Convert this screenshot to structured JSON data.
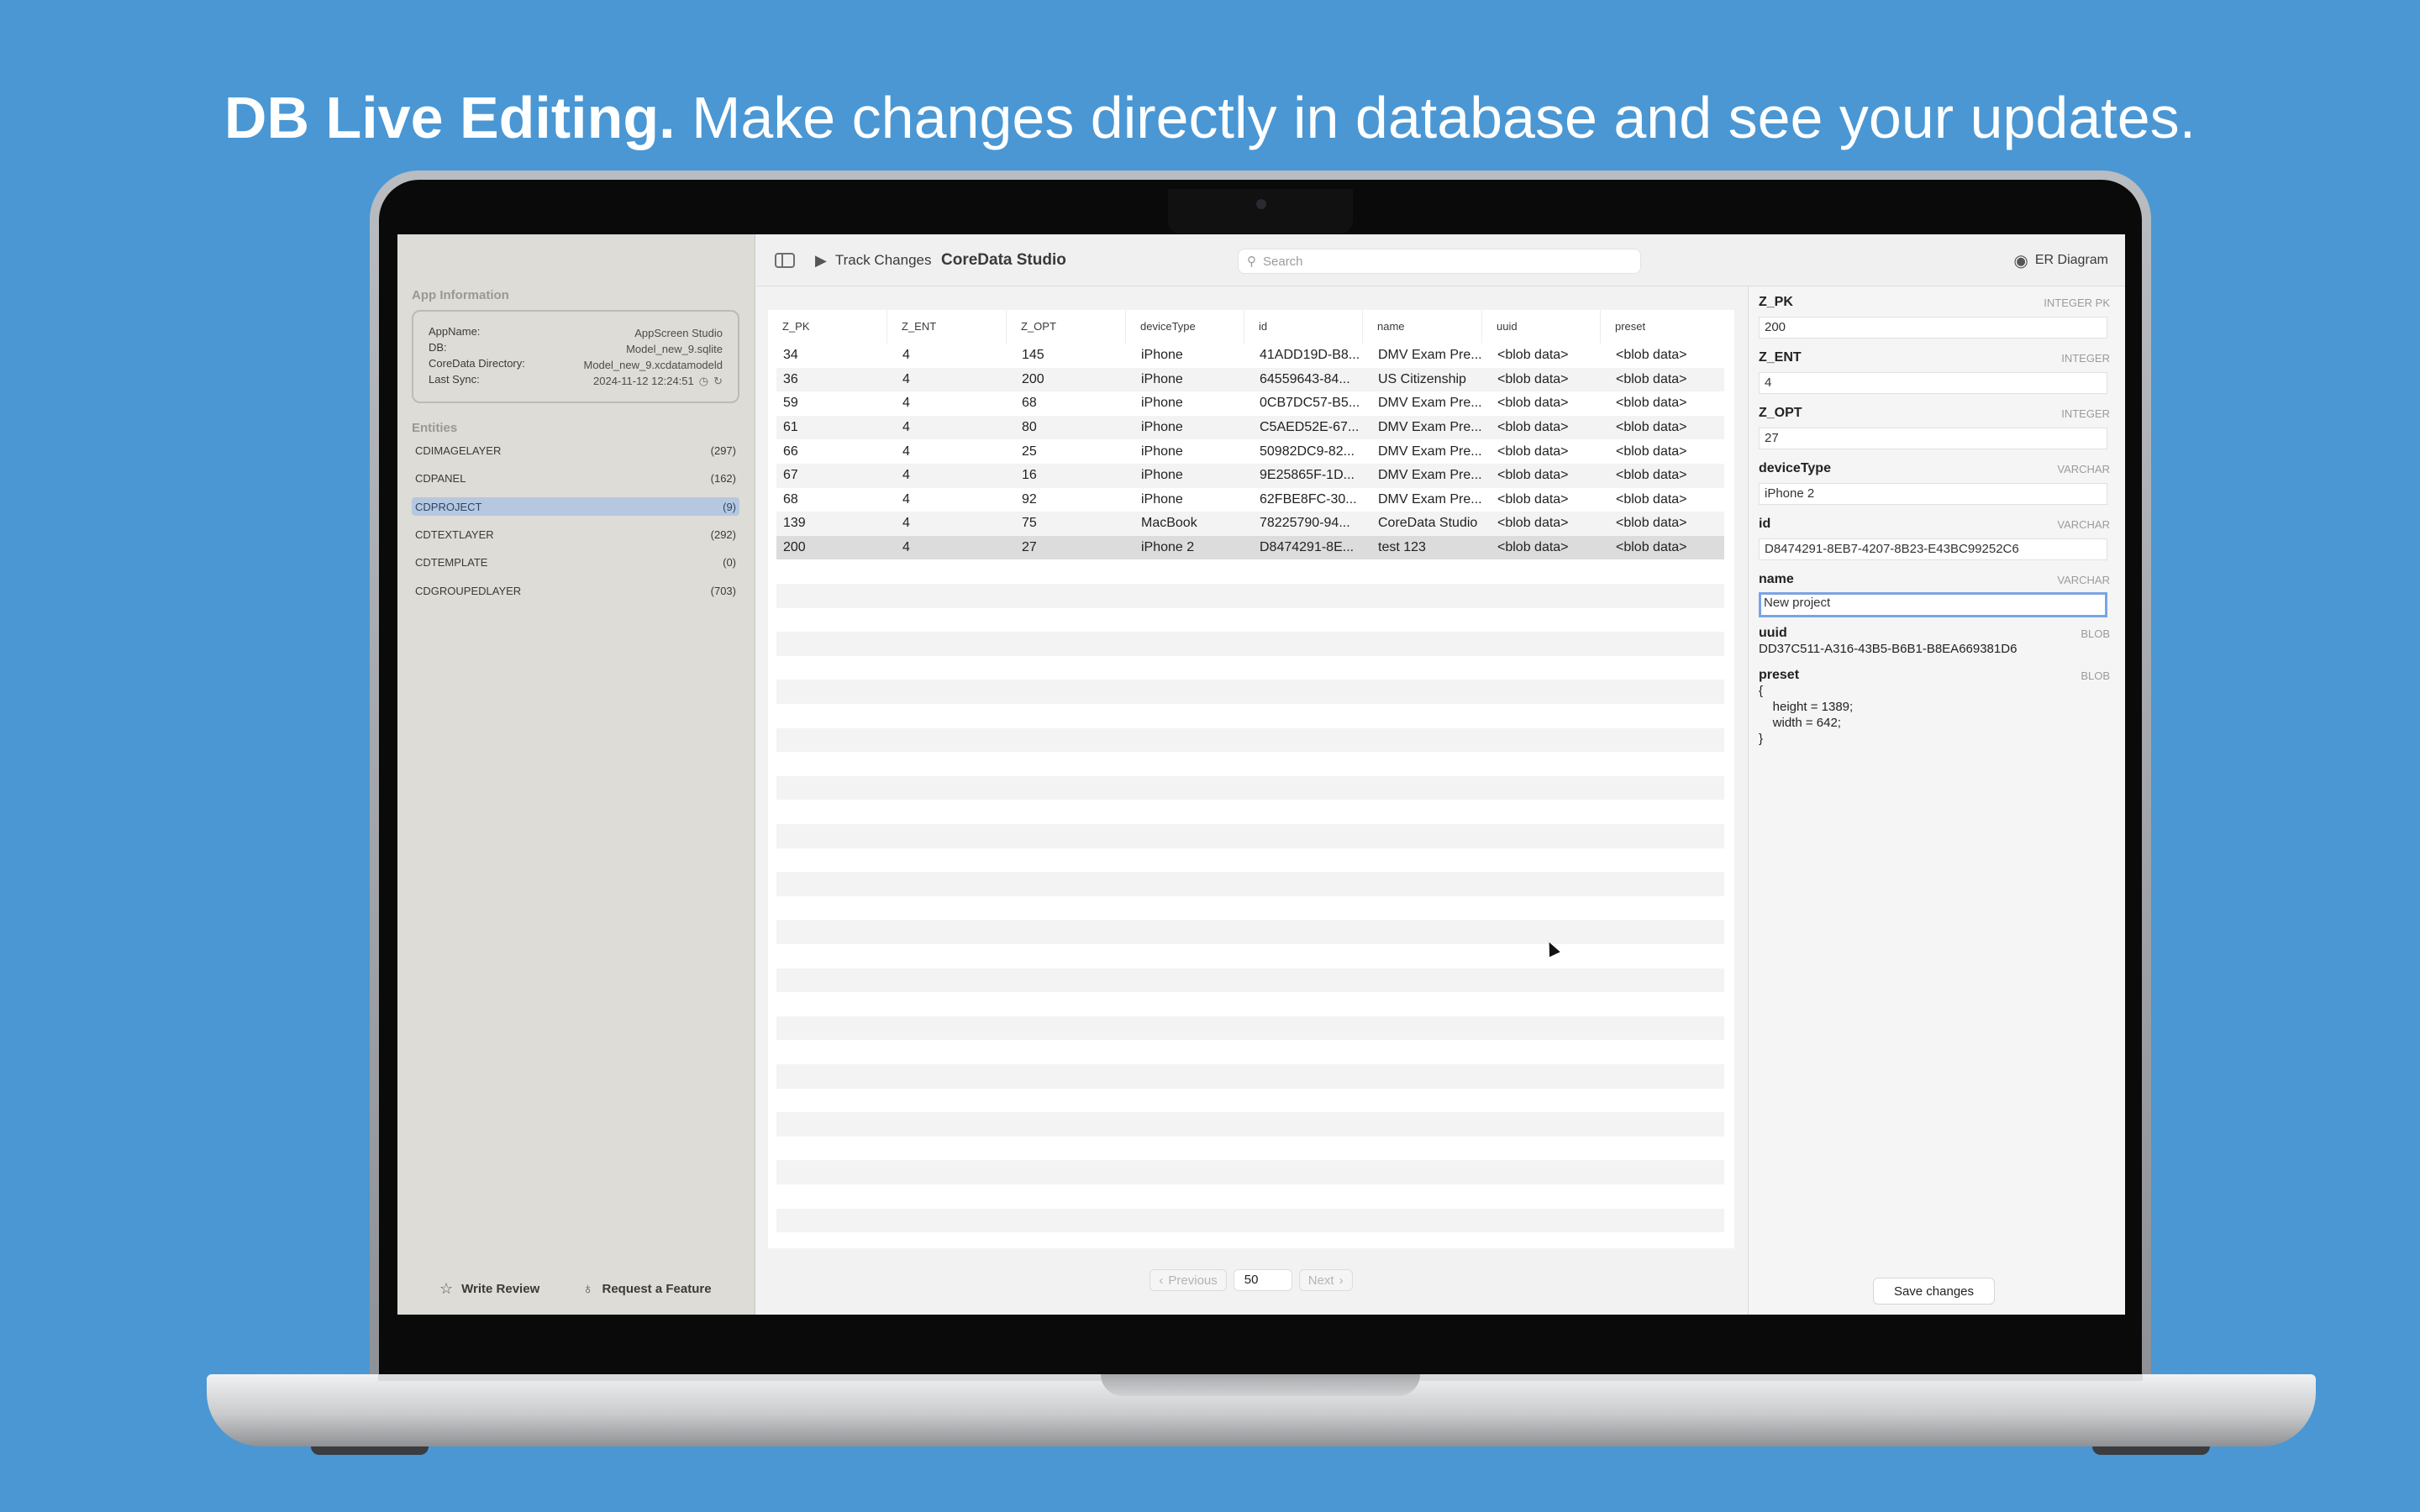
{
  "headline": {
    "bold": "DB Live Editing.",
    "rest": "Make changes directly in database and see your updates."
  },
  "sidebar": {
    "app_info_title": "App Information",
    "app_info": [
      {
        "key": "AppName:",
        "value": "AppScreen Studio"
      },
      {
        "key": "DB:",
        "value": "Model_new_9.sqlite"
      },
      {
        "key": "CoreData Directory:",
        "value": "Model_new_9.xcdatamodeld"
      },
      {
        "key": "Last Sync:",
        "value": "2024-11-12 12:24:51"
      }
    ],
    "entities_title": "Entities",
    "entities": [
      {
        "name": "CDIMAGELAYER",
        "count": "(297)"
      },
      {
        "name": "CDPANEL",
        "count": "(162)"
      },
      {
        "name": "CDPROJECT",
        "count": "(9)"
      },
      {
        "name": "CDTEXTLAYER",
        "count": "(292)"
      },
      {
        "name": "CDTEMPLATE",
        "count": "(0)"
      },
      {
        "name": "CDGROUPEDLAYER",
        "count": "(703)"
      }
    ],
    "write_review": "Write Review",
    "request_feature": "Request a Feature"
  },
  "toolbar": {
    "track_changes": "Track Changes",
    "app_title": "CoreData Studio",
    "search_placeholder": "Search",
    "er_diagram": "ER Diagram"
  },
  "table": {
    "columns": [
      "Z_PK",
      "Z_ENT",
      "Z_OPT",
      "deviceType",
      "id",
      "name",
      "uuid",
      "preset"
    ],
    "rows": [
      [
        "34",
        "4",
        "145",
        "iPhone",
        "41ADD19D-B8...",
        "DMV Exam Pre...",
        "<blob data>",
        "<blob data>"
      ],
      [
        "36",
        "4",
        "200",
        "iPhone",
        "64559643-84...",
        "US Citizenship",
        "<blob data>",
        "<blob data>"
      ],
      [
        "59",
        "4",
        "68",
        "iPhone",
        "0CB7DC57-B5...",
        "DMV Exam Pre...",
        "<blob data>",
        "<blob data>"
      ],
      [
        "61",
        "4",
        "80",
        "iPhone",
        "C5AED52E-67...",
        "DMV Exam Pre...",
        "<blob data>",
        "<blob data>"
      ],
      [
        "66",
        "4",
        "25",
        "iPhone",
        "50982DC9-82...",
        "DMV Exam Pre...",
        "<blob data>",
        "<blob data>"
      ],
      [
        "67",
        "4",
        "16",
        "iPhone",
        "9E25865F-1D...",
        "DMV Exam Pre...",
        "<blob data>",
        "<blob data>"
      ],
      [
        "68",
        "4",
        "92",
        "iPhone",
        "62FBE8FC-30...",
        "DMV Exam Pre...",
        "<blob data>",
        "<blob data>"
      ],
      [
        "139",
        "4",
        "75",
        "MacBook",
        "78225790-94...",
        "CoreData Studio",
        "<blob data>",
        "<blob data>"
      ],
      [
        "200",
        "4",
        "27",
        "iPhone 2",
        "D8474291-8E...",
        "test 123",
        "<blob data>",
        "<blob data>"
      ]
    ]
  },
  "pager": {
    "previous": "Previous",
    "page_size": "50",
    "next": "Next"
  },
  "inspector": {
    "fields": [
      {
        "name": "Z_PK",
        "type": "INTEGER  PK",
        "value": "200"
      },
      {
        "name": "Z_ENT",
        "type": "INTEGER",
        "value": "4"
      },
      {
        "name": "Z_OPT",
        "type": "INTEGER",
        "value": "27"
      },
      {
        "name": "deviceType",
        "type": "VARCHAR",
        "value": "iPhone 2"
      },
      {
        "name": "id",
        "type": "VARCHAR",
        "value": "D8474291-8EB7-4207-8B23-E43BC99252C6"
      },
      {
        "name": "name",
        "type": "VARCHAR",
        "value": "New project"
      },
      {
        "name": "uuid",
        "type": "BLOB",
        "value": "DD37C511-A316-43B5-B6B1-B8EA669381D6"
      },
      {
        "name": "preset",
        "type": "BLOB",
        "value": "{\n    height = 1389;\n    width = 642;\n}"
      }
    ],
    "save": "Save changes"
  },
  "colors": {
    "background": "#4a97d4",
    "selection": "#b6c8e0",
    "focus_ring": "#7aa3e6"
  },
  "icons": [
    "sidebar-toggle-icon",
    "play-icon",
    "search-icon",
    "eye-icon",
    "star-icon",
    "lightbulb-icon",
    "clock-icon",
    "refresh-icon",
    "chevron-left-icon",
    "chevron-right-icon"
  ]
}
